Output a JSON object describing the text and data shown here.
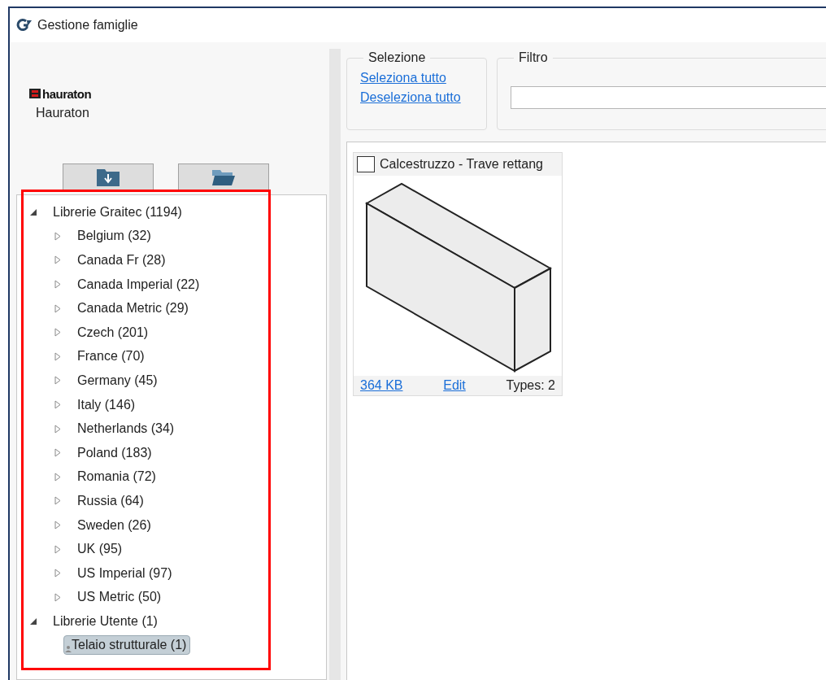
{
  "window": {
    "title": "Gestione famiglie"
  },
  "brand": {
    "logo_text": "hauraton",
    "name": "Hauraton"
  },
  "tree": [
    {
      "label": "Librerie Graitec (1194)",
      "expanded": true,
      "selected": false,
      "children": [
        {
          "label": "Belgium (32)",
          "expanded": false,
          "selected": false
        },
        {
          "label": "Canada Fr (28)",
          "expanded": false,
          "selected": false
        },
        {
          "label": "Canada Imperial (22)",
          "expanded": false,
          "selected": false
        },
        {
          "label": "Canada Metric (29)",
          "expanded": false,
          "selected": false
        },
        {
          "label": "Czech (201)",
          "expanded": false,
          "selected": false
        },
        {
          "label": "France (70)",
          "expanded": false,
          "selected": false
        },
        {
          "label": "Germany (45)",
          "expanded": false,
          "selected": false
        },
        {
          "label": "Italy (146)",
          "expanded": false,
          "selected": false
        },
        {
          "label": "Netherlands (34)",
          "expanded": false,
          "selected": false
        },
        {
          "label": "Poland (183)",
          "expanded": false,
          "selected": false
        },
        {
          "label": "Romania (72)",
          "expanded": false,
          "selected": false
        },
        {
          "label": "Russia (64)",
          "expanded": false,
          "selected": false
        },
        {
          "label": "Sweden (26)",
          "expanded": false,
          "selected": false
        },
        {
          "label": "UK (95)",
          "expanded": false,
          "selected": false
        },
        {
          "label": "US Imperial (97)",
          "expanded": false,
          "selected": false
        },
        {
          "label": "US Metric (50)",
          "expanded": false,
          "selected": false
        }
      ]
    },
    {
      "label": "Librerie Utente (1)",
      "expanded": true,
      "selected": false,
      "children": [
        {
          "label": "Telaio strutturale (1)",
          "kind": "user",
          "selected": true
        }
      ]
    }
  ],
  "selection": {
    "title": "Selezione",
    "links": [
      "Seleziona tutto",
      "Deseleziona tutto"
    ]
  },
  "filter": {
    "title": "Filtro"
  },
  "cards": [
    {
      "title": "Calcestruzzo - Trave rettang",
      "checked": false,
      "size": "364 KB",
      "edit": "Edit",
      "types": "Types: 2"
    }
  ]
}
